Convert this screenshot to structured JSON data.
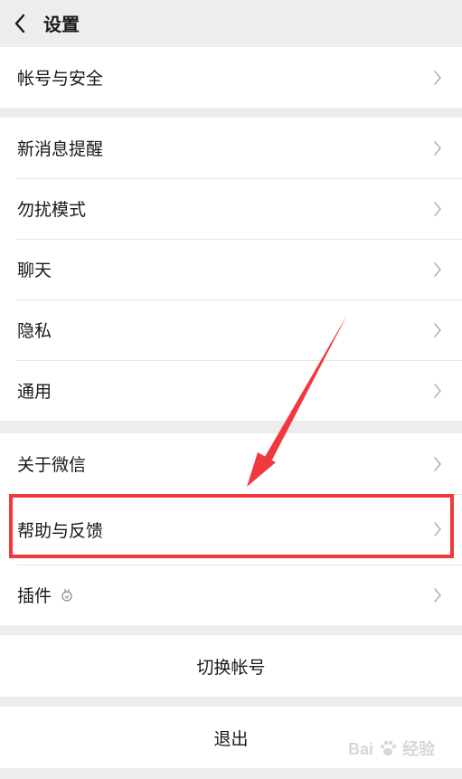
{
  "header": {
    "title": "设置"
  },
  "groups": {
    "account": {
      "items": [
        {
          "label": "帐号与安全"
        }
      ]
    },
    "main": {
      "items": [
        {
          "label": "新消息提醒"
        },
        {
          "label": "勿扰模式"
        },
        {
          "label": "聊天"
        },
        {
          "label": "隐私"
        },
        {
          "label": "通用"
        }
      ]
    },
    "about": {
      "items": [
        {
          "label": "关于微信"
        },
        {
          "label": "帮助与反馈"
        },
        {
          "label": "插件"
        }
      ]
    }
  },
  "actions": {
    "switch_account": "切换帐号",
    "logout": "退出"
  },
  "annotation": {
    "highlight_color": "#f0393e"
  },
  "watermark": {
    "text": "Bai",
    "text2": "经验"
  },
  "icons": {
    "back": "chevron-left-icon",
    "row_chevron": "chevron-right-icon",
    "plugin": "plugin-badge-icon"
  }
}
